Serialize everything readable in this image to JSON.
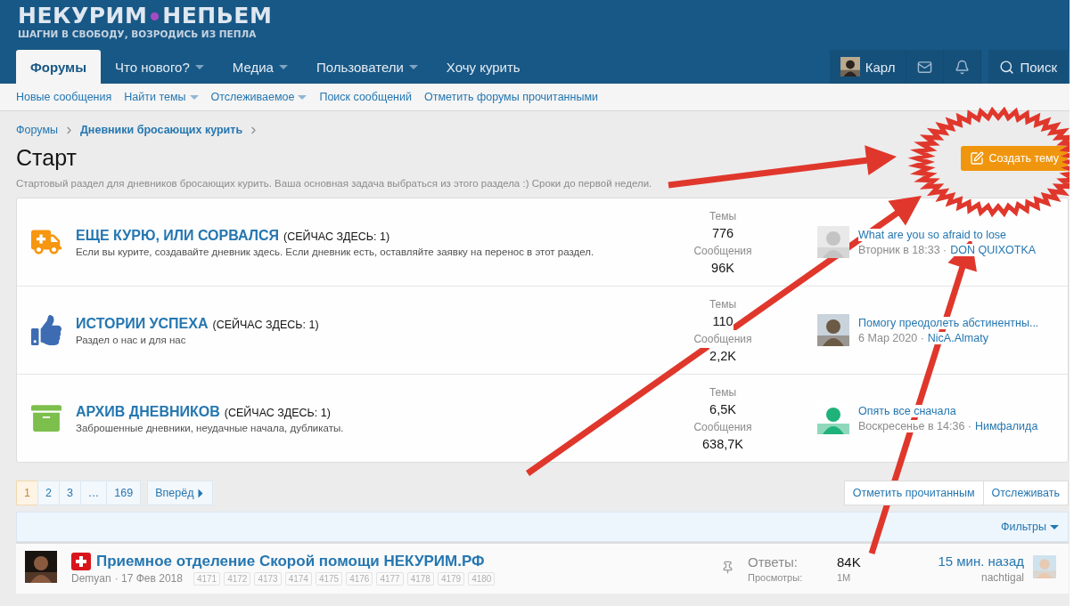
{
  "logo": {
    "left": "НЕКУРИМ",
    "right": "НЕПЬЕМ",
    "tagline": "ШАГНИ В СВОБОДУ, ВОЗРОДИСЬ ИЗ ПЕПЛА"
  },
  "nav": [
    {
      "label": "Форумы",
      "selected": true,
      "dropdown": false
    },
    {
      "label": "Что нового?",
      "selected": false,
      "dropdown": true
    },
    {
      "label": "Медиа",
      "selected": false,
      "dropdown": true
    },
    {
      "label": "Пользователи",
      "selected": false,
      "dropdown": true
    },
    {
      "label": "Хочу курить",
      "selected": false,
      "dropdown": false
    }
  ],
  "user": {
    "name": "Карл"
  },
  "search_label": "Поиск",
  "subnav": [
    {
      "label": "Новые сообщения",
      "dropdown": false
    },
    {
      "label": "Найти темы",
      "dropdown": true
    },
    {
      "label": "Отслеживаемое",
      "dropdown": true
    },
    {
      "label": "Поиск сообщений",
      "dropdown": false
    },
    {
      "label": "Отметить форумы прочитанными",
      "dropdown": false
    }
  ],
  "breadcrumbs": [
    {
      "label": "Форумы",
      "bold": false
    },
    {
      "label": "Дневники бросающих курить",
      "bold": true
    }
  ],
  "page": {
    "title": "Старт",
    "description": "Стартовый раздел для дневников бросающих курить. Ваша основная задача выбраться из этого раздела :) Сроки до первой недели.",
    "create_button": "Создать тему"
  },
  "nodes": [
    {
      "title": "ЕЩЕ КУРЮ, ИЛИ СОРВАЛСЯ",
      "viewers": "(СЕЙЧАС ЗДЕСЬ: 1)",
      "description": "Если вы курите, создавайте дневник здесь. Если дневник есть, оставляйте заявку на перенос в этот раздел.",
      "stats": [
        {
          "label": "Темы",
          "value": "776"
        },
        {
          "label": "Сообщения",
          "value": "96K"
        }
      ],
      "last_post": {
        "title": "What are you so afraid to lose",
        "date": "Вторник в 18:33 ·",
        "author": "DON QUIXOTKA"
      }
    },
    {
      "title": "ИСТОРИИ УСПЕХА",
      "viewers": "(СЕЙЧАС ЗДЕСЬ: 1)",
      "description": "Раздел о нас и для нас",
      "stats": [
        {
          "label": "Темы",
          "value": "110"
        },
        {
          "label": "Сообщения",
          "value": "2,2K"
        }
      ],
      "last_post": {
        "title": "Помогу преодолеть абстинентны...",
        "date": "6 Мар 2020 ·",
        "author": "NicA.Almaty"
      }
    },
    {
      "title": "АРХИВ ДНЕВНИКОВ",
      "viewers": "(СЕЙЧАС ЗДЕСЬ: 1)",
      "description": "Заброшенные дневники, неудачные начала, дубликаты.",
      "stats": [
        {
          "label": "Темы",
          "value": "6,5K"
        },
        {
          "label": "Сообщения",
          "value": "638,7K"
        }
      ],
      "last_post": {
        "title": "Опять все сначала",
        "date": "Воскресенье в 14:36 ·",
        "author": "Нимфалида"
      }
    }
  ],
  "pagination": {
    "pages": [
      {
        "label": "1",
        "selected": true
      },
      {
        "label": "2",
        "selected": false
      },
      {
        "label": "3",
        "selected": false
      },
      {
        "label": "…",
        "selected": false
      },
      {
        "label": "169",
        "selected": false
      }
    ],
    "next": "Вперёд"
  },
  "actions": [
    "Отметить прочитанным",
    "Отслеживать"
  ],
  "filters": "Фильтры",
  "threads": [
    {
      "title": "Приемное отделение Скорой помощи НЕКУРИМ.РФ",
      "author": "Demyan",
      "date": "· 17 Фев 2018",
      "pages": [
        "4171",
        "4172",
        "4173",
        "4174",
        "4175",
        "4176",
        "4177",
        "4178",
        "4179",
        "4180"
      ],
      "pinned": true,
      "replies_label": "Ответы:",
      "replies": "84K",
      "views_label": "Просмотры:",
      "views": "1M",
      "last_time": "15 мин. назад",
      "last_author": "nachtigal"
    }
  ]
}
